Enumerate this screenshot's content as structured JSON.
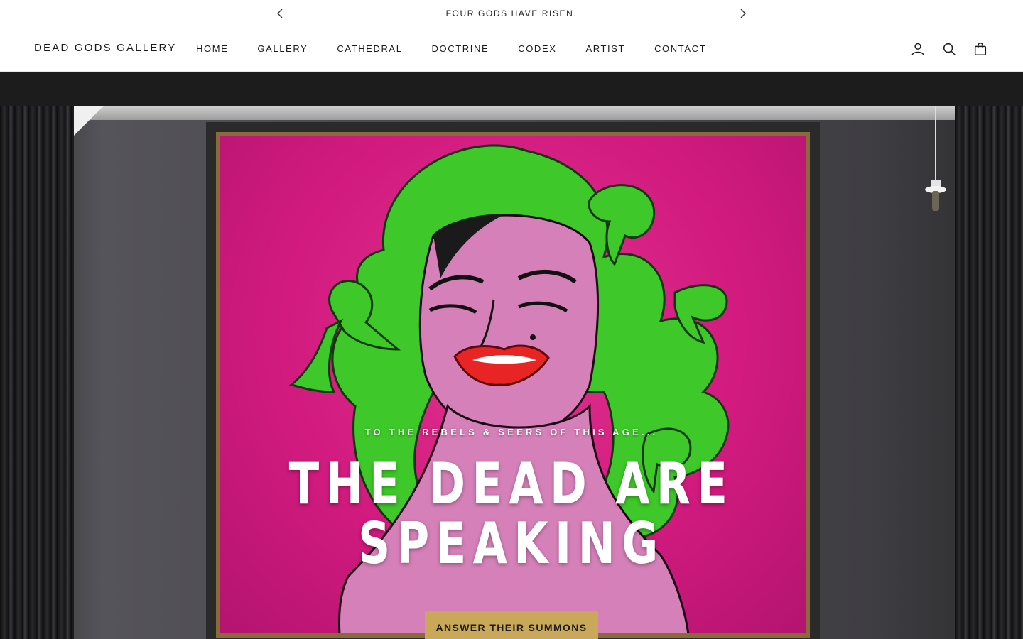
{
  "announcement": {
    "text": "FOUR GODS HAVE RISEN.",
    "prev_icon": "chevron-left-icon",
    "next_icon": "chevron-right-icon"
  },
  "header": {
    "logo": "DEAD GODS GALLERY",
    "nav": [
      "HOME",
      "GALLERY",
      "CATHEDRAL",
      "DOCTRINE",
      "CODEX",
      "ARTIST",
      "CONTACT"
    ],
    "icons": [
      "account-icon",
      "search-icon",
      "cart-icon"
    ]
  },
  "hero": {
    "kicker": "TO THE REBELS & SEERS OF THIS AGE...",
    "headline_line1": "THE DEAD ARE",
    "headline_line2": "SPEAKING",
    "cta": "ANSWER THEIR SUMMONS"
  },
  "colors": {
    "accent_gold": "#c9a85a",
    "canvas_pink": "#d21a7f",
    "snake_green": "#3ec829"
  }
}
